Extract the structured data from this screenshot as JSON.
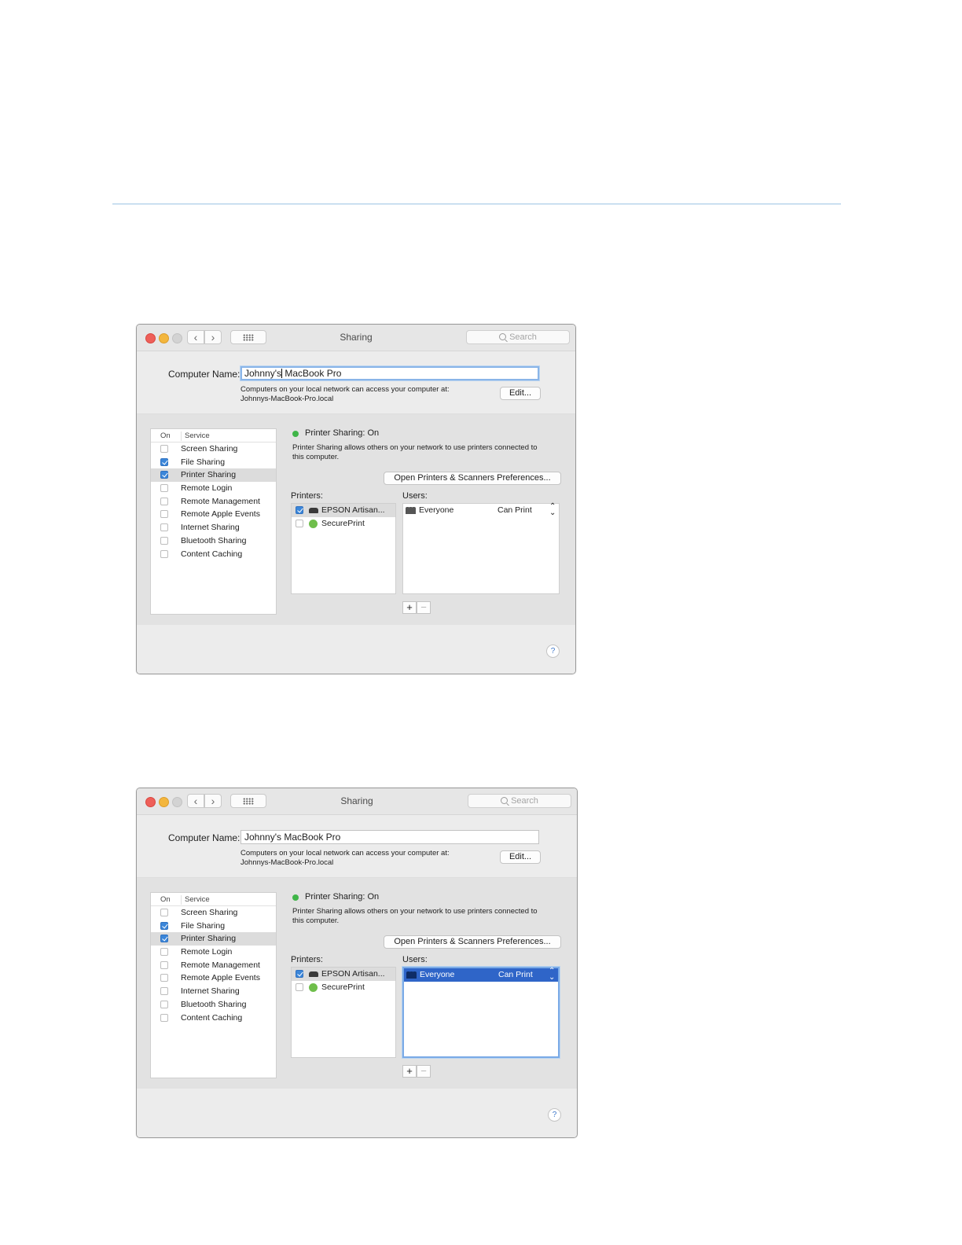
{
  "windows": [
    {
      "title": "Sharing",
      "search_placeholder": "Search",
      "computer_name_label": "Computer Name:",
      "computer_name_before_caret": "Johnny's",
      "computer_name_after_caret": " MacBook Pro",
      "computer_name_focused": true,
      "address_help_line1": "Computers on your local network can access your computer at:",
      "address_help_line2": "Johnnys-MacBook-Pro.local",
      "edit_label": "Edit...",
      "service_header_on": "On",
      "service_header_service": "Service",
      "services": [
        {
          "label": "Screen Sharing",
          "checked": false,
          "selected": false
        },
        {
          "label": "File Sharing",
          "checked": true,
          "selected": false
        },
        {
          "label": "Printer Sharing",
          "checked": true,
          "selected": true
        },
        {
          "label": "Remote Login",
          "checked": false,
          "selected": false
        },
        {
          "label": "Remote Management",
          "checked": false,
          "selected": false
        },
        {
          "label": "Remote Apple Events",
          "checked": false,
          "selected": false
        },
        {
          "label": "Internet Sharing",
          "checked": false,
          "selected": false
        },
        {
          "label": "Bluetooth Sharing",
          "checked": false,
          "selected": false
        },
        {
          "label": "Content Caching",
          "checked": false,
          "selected": false
        }
      ],
      "status": "Printer Sharing: On",
      "status_color": "#3fb548",
      "description_line1": "Printer Sharing allows others on your network to use printers connected to",
      "description_line2": "this computer.",
      "open_prefs_label": "Open Printers & Scanners Preferences...",
      "printers_label": "Printers:",
      "users_label": "Users:",
      "printers": [
        {
          "label": "EPSON Artisan...",
          "checked": true,
          "icon": "printer-icon",
          "selected": true
        },
        {
          "label": "SecurePrint",
          "checked": false,
          "icon": "secure-print-icon",
          "selected": false
        }
      ],
      "users": [
        {
          "name": "Everyone",
          "permission": "Can Print",
          "selected": false
        }
      ],
      "users_list_focused": false,
      "plus_label": "+",
      "minus_label": "−",
      "help_label": "?"
    },
    {
      "title": "Sharing",
      "search_placeholder": "Search",
      "computer_name_label": "Computer Name:",
      "computer_name_before_caret": "Johnny's MacBook Pro",
      "computer_name_after_caret": "",
      "computer_name_focused": false,
      "address_help_line1": "Computers on your local network can access your computer at:",
      "address_help_line2": "Johnnys-MacBook-Pro.local",
      "edit_label": "Edit...",
      "service_header_on": "On",
      "service_header_service": "Service",
      "services": [
        {
          "label": "Screen Sharing",
          "checked": false,
          "selected": false
        },
        {
          "label": "File Sharing",
          "checked": true,
          "selected": false
        },
        {
          "label": "Printer Sharing",
          "checked": true,
          "selected": true
        },
        {
          "label": "Remote Login",
          "checked": false,
          "selected": false
        },
        {
          "label": "Remote Management",
          "checked": false,
          "selected": false
        },
        {
          "label": "Remote Apple Events",
          "checked": false,
          "selected": false
        },
        {
          "label": "Internet Sharing",
          "checked": false,
          "selected": false
        },
        {
          "label": "Bluetooth Sharing",
          "checked": false,
          "selected": false
        },
        {
          "label": "Content Caching",
          "checked": false,
          "selected": false
        }
      ],
      "status": "Printer Sharing: On",
      "status_color": "#3fb548",
      "description_line1": "Printer Sharing allows others on your network to use printers connected to",
      "description_line2": "this computer.",
      "open_prefs_label": "Open Printers & Scanners Preferences...",
      "printers_label": "Printers:",
      "users_label": "Users:",
      "printers": [
        {
          "label": "EPSON Artisan...",
          "checked": true,
          "icon": "printer-icon",
          "selected": true
        },
        {
          "label": "SecurePrint",
          "checked": false,
          "icon": "secure-print-icon",
          "selected": false
        }
      ],
      "users": [
        {
          "name": "Everyone",
          "permission": "Can Print",
          "selected": true
        }
      ],
      "users_list_focused": true,
      "plus_label": "+",
      "minus_label": "−",
      "help_label": "?"
    }
  ]
}
